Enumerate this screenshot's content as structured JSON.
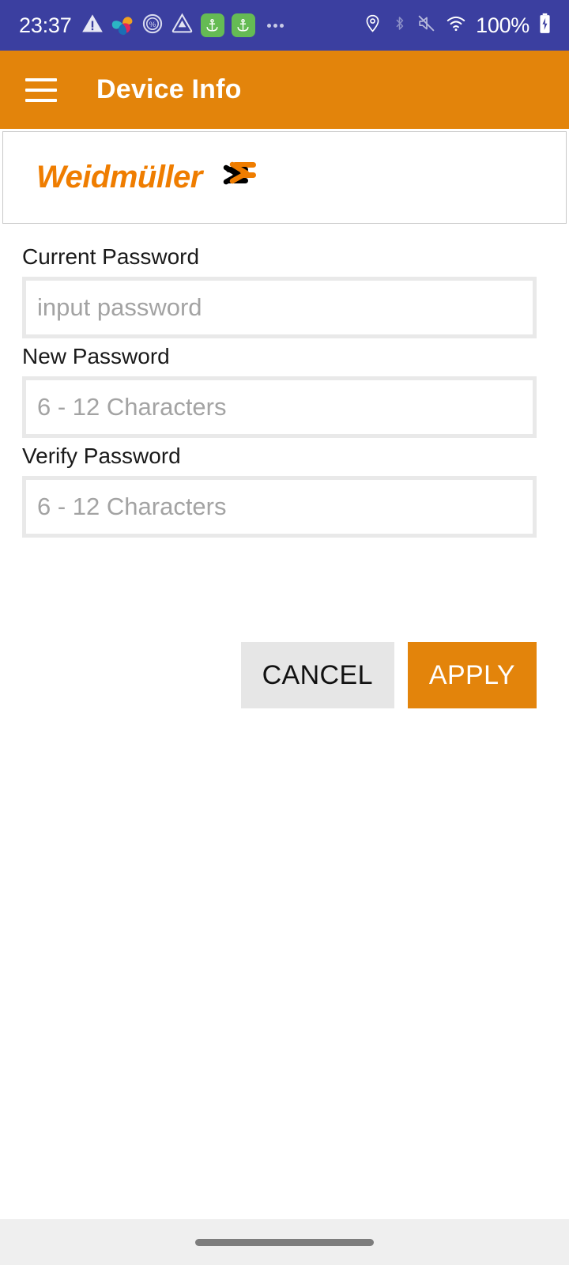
{
  "status_bar": {
    "time": "23:37",
    "battery_percent": "100%",
    "left_icons": [
      "warning-triangle-icon",
      "pinwheel-app-icon",
      "percent-circle-icon",
      "triangle-alert-app-icon",
      "anchor-badge-icon",
      "anchor-badge-icon",
      "more-notifications-icon"
    ],
    "right_icons": [
      "location-pin-icon",
      "bluetooth-icon",
      "sound-muted-icon",
      "wifi-icon",
      "battery-charging-icon"
    ],
    "background_color": "#3b3fa0",
    "badge_color": "#65bb54"
  },
  "app_bar": {
    "menu_label": "menu",
    "title": "Device Info",
    "background_color": "#e3840b"
  },
  "brand_card": {
    "logo_text": "Weidmüller",
    "logo_color": "#ef7d00",
    "mark_colors": [
      "#000000",
      "#ef7d00"
    ]
  },
  "form": {
    "fields": [
      {
        "label": "Current Password",
        "value": "",
        "placeholder": "input password"
      },
      {
        "label": "New Password",
        "value": "",
        "placeholder": "6 - 12 Characters"
      },
      {
        "label": "Verify Password",
        "value": "",
        "placeholder": "6 - 12 Characters"
      }
    ]
  },
  "actions": {
    "cancel_label": "CANCEL",
    "apply_label": "APPLY",
    "apply_color": "#e3840b",
    "cancel_color": "#e6e6e6"
  },
  "nav_bar": {
    "handle": "home-gesture-handle"
  }
}
